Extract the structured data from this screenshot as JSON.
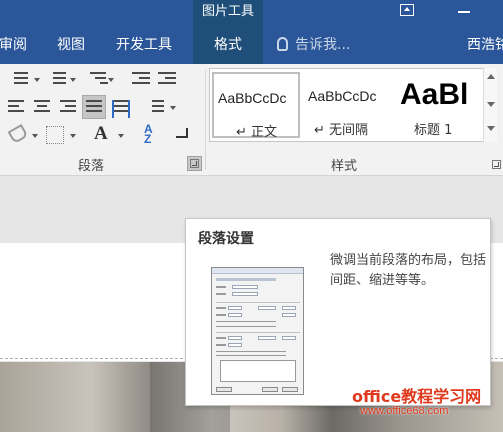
{
  "context_tab_header": "图片工具",
  "tabs": [
    {
      "label": "审阅",
      "active": false
    },
    {
      "label": "视图",
      "active": false
    },
    {
      "label": "开发工具",
      "active": false
    },
    {
      "label": "格式",
      "active": true
    }
  ],
  "tell_me": {
    "placeholder": "告诉我..."
  },
  "user_name": "西浩铭",
  "ribbon": {
    "paragraph_group_label": "段落",
    "styles_group_label": "样式",
    "styles": [
      {
        "sample": "AaBbCcDc",
        "name": "↵ 正文",
        "selected": true
      },
      {
        "sample": "AaBbCcDc",
        "name": "↵ 无间隔",
        "selected": false
      },
      {
        "sample": "AaBl",
        "name": "标题 1",
        "selected": false
      }
    ]
  },
  "tooltip": {
    "title": "段落设置",
    "description": "微调当前段落的布局，包括间距、缩进等等。"
  },
  "watermark": {
    "main": "office教程学习网",
    "url": "www.office68.com"
  },
  "colors": {
    "ribbon_tab_bg": "#2b579a",
    "active_tab_bg": "#1e4e79",
    "ribbon_bg": "#f2f2f2",
    "watermark": "#e03a1e"
  },
  "icons": [
    "restore-icon",
    "minimize-icon",
    "lightbulb-icon",
    "bullets-icon",
    "numbering-icon",
    "multilevel-list-icon",
    "decrease-indent-icon",
    "increase-indent-icon",
    "align-left-icon",
    "align-center-icon",
    "align-right-icon",
    "justify-icon",
    "distributed-icon",
    "line-spacing-icon",
    "shading-icon",
    "borders-icon",
    "asian-layout-icon",
    "sort-icon",
    "show-marks-icon",
    "dialog-launcher-icon"
  ]
}
